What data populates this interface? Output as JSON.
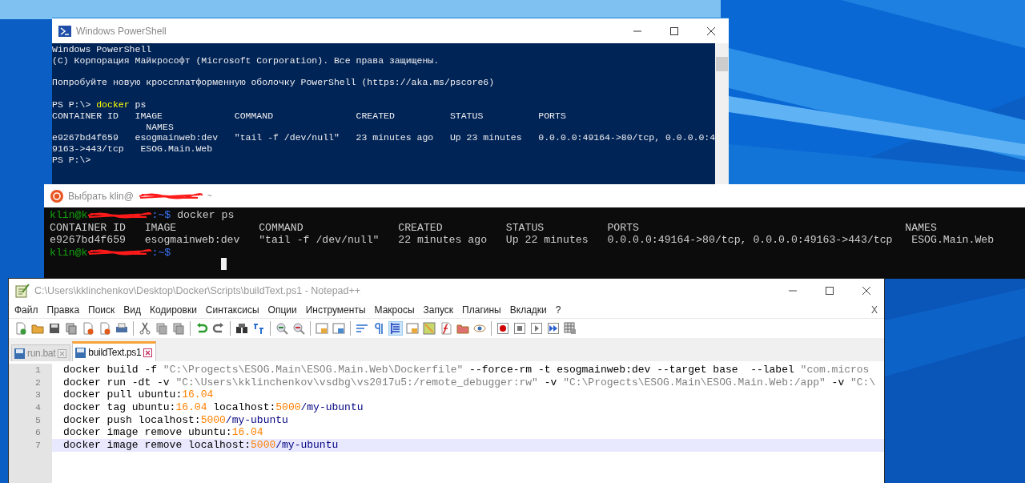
{
  "powershell": {
    "title": "Windows PowerShell",
    "blocks": [
      {
        "lines": [
          {
            "segments": [
              {
                "kind": "plain",
                "text": "Windows PowerShell"
              }
            ]
          },
          {
            "segments": [
              {
                "kind": "plain",
                "text": "(C) Корпорация Майкрософт (Microsoft Corporation). Все права защищены."
              }
            ]
          }
        ]
      },
      {
        "lines": [
          {
            "segments": [
              {
                "kind": "plain",
                "text": "Попробуйте новую кроссплатформенную оболочку PowerShell (https://aka.ms/pscore6)"
              }
            ]
          }
        ]
      },
      {
        "lines": [
          {
            "segments": [
              {
                "kind": "plain",
                "text": "PS P:\\> "
              },
              {
                "kind": "cmdlet",
                "text": "docker"
              },
              {
                "kind": "plain",
                "text": " ps"
              }
            ]
          },
          {
            "segments": [
              {
                "kind": "plain",
                "text": "CONTAINER ID   IMAGE             COMMAND               CREATED          STATUS          PORTS"
              }
            ]
          },
          {
            "segments": [
              {
                "kind": "plain",
                "text": "                 NAMES"
              }
            ]
          },
          {
            "segments": [
              {
                "kind": "plain",
                "text": "e9267bd4f659   esogmainweb:dev   \"tail -f /dev/null\"   23 minutes ago   Up 23 minutes   0.0.0.0:49164->80/tcp, 0.0.0.0:4"
              }
            ]
          },
          {
            "segments": [
              {
                "kind": "plain",
                "text": "9163->443/tcp   ESOG.Main.Web"
              }
            ]
          },
          {
            "segments": [
              {
                "kind": "plain",
                "text": "PS P:\\>"
              }
            ]
          }
        ]
      }
    ]
  },
  "ubuntu": {
    "title": "Выбрать klin@",
    "title_redacted": true,
    "title_suffix": "~",
    "cursor_visible": true,
    "lines": [
      {
        "segments": [
          {
            "kind": "user",
            "text": "klin@k"
          },
          {
            "kind": "redacted"
          },
          {
            "kind": "path",
            "text": ":~$"
          },
          {
            "kind": "plain",
            "text": " docker ps"
          }
        ]
      },
      {
        "segments": [
          {
            "kind": "plain",
            "text": "CONTAINER ID   IMAGE             COMMAND               CREATED          STATUS          PORTS                                          NAMES"
          }
        ]
      },
      {
        "segments": [
          {
            "kind": "plain",
            "text": "e9267bd4f659   esogmainweb:dev   \"tail -f /dev/null\"   22 minutes ago   Up 22 minutes   0.0.0.0:49164->80/tcp, 0.0.0.0:49163->443/tcp   ESOG.Main.Web"
          }
        ]
      },
      {
        "segments": [
          {
            "kind": "user",
            "text": "klin@k"
          },
          {
            "kind": "redacted"
          },
          {
            "kind": "path",
            "text": ":~$"
          }
        ]
      }
    ]
  },
  "notepad": {
    "title": "C:\\Users\\kklinchenkov\\Desktop\\Docker\\Scripts\\buildText.ps1 - Notepad++",
    "menu": [
      "Файл",
      "Правка",
      "Поиск",
      "Вид",
      "Кодировки",
      "Синтаксисы",
      "Опции",
      "Инструменты",
      "Макросы",
      "Запуск",
      "Плагины",
      "Вкладки",
      "?"
    ],
    "menu_close": "X",
    "tabs": [
      {
        "label": "run.bat",
        "selected": false
      },
      {
        "label": "buildText.ps1",
        "selected": true
      }
    ],
    "lines": [
      {
        "number": "1",
        "selected": false,
        "segments": [
          {
            "kind": "plain",
            "text": "docker build -f "
          },
          {
            "kind": "string",
            "text": "\"C:\\Progects\\ESOG.Main\\ESOG.Main.Web\\Dockerfile\""
          },
          {
            "kind": "plain",
            "text": " --force-rm -t esogmainweb:dev --target base  --label "
          },
          {
            "kind": "string",
            "text": "\"com.micros"
          }
        ]
      },
      {
        "number": "2",
        "selected": false,
        "segments": [
          {
            "kind": "plain",
            "text": "docker run -dt -v "
          },
          {
            "kind": "string",
            "text": "\"C:\\Users\\kklinchenkov\\vsdbg\\vs2017u5:/remote_debugger:rw\""
          },
          {
            "kind": "plain",
            "text": " -v "
          },
          {
            "kind": "string",
            "text": "\"C:\\Progects\\ESOG.Main\\ESOG.Main.Web:/app\""
          },
          {
            "kind": "plain",
            "text": " -v "
          },
          {
            "kind": "string",
            "text": "\"C:\\"
          }
        ]
      },
      {
        "number": "3",
        "selected": false,
        "segments": [
          {
            "kind": "plain",
            "text": "docker pull ubuntu:"
          },
          {
            "kind": "number",
            "text": "16.04"
          }
        ]
      },
      {
        "number": "4",
        "selected": false,
        "segments": [
          {
            "kind": "plain",
            "text": "docker tag ubuntu:"
          },
          {
            "kind": "number",
            "text": "16.04"
          },
          {
            "kind": "plain",
            "text": " localhost:"
          },
          {
            "kind": "number",
            "text": "5000"
          },
          {
            "kind": "operator",
            "text": "/my-ubuntu"
          }
        ]
      },
      {
        "number": "5",
        "selected": false,
        "segments": [
          {
            "kind": "plain",
            "text": "docker push localhost:"
          },
          {
            "kind": "number",
            "text": "5000"
          },
          {
            "kind": "operator",
            "text": "/my-ubuntu"
          }
        ]
      },
      {
        "number": "6",
        "selected": false,
        "segments": [
          {
            "kind": "plain",
            "text": "docker image remove ubuntu:"
          },
          {
            "kind": "number",
            "text": "16.04"
          }
        ]
      },
      {
        "number": "7",
        "selected": true,
        "segments": [
          {
            "kind": "plain",
            "text": "docker image remove localhost:"
          },
          {
            "kind": "number",
            "text": "5000"
          },
          {
            "kind": "operator",
            "text": "/my-ubuntu"
          }
        ]
      }
    ]
  }
}
